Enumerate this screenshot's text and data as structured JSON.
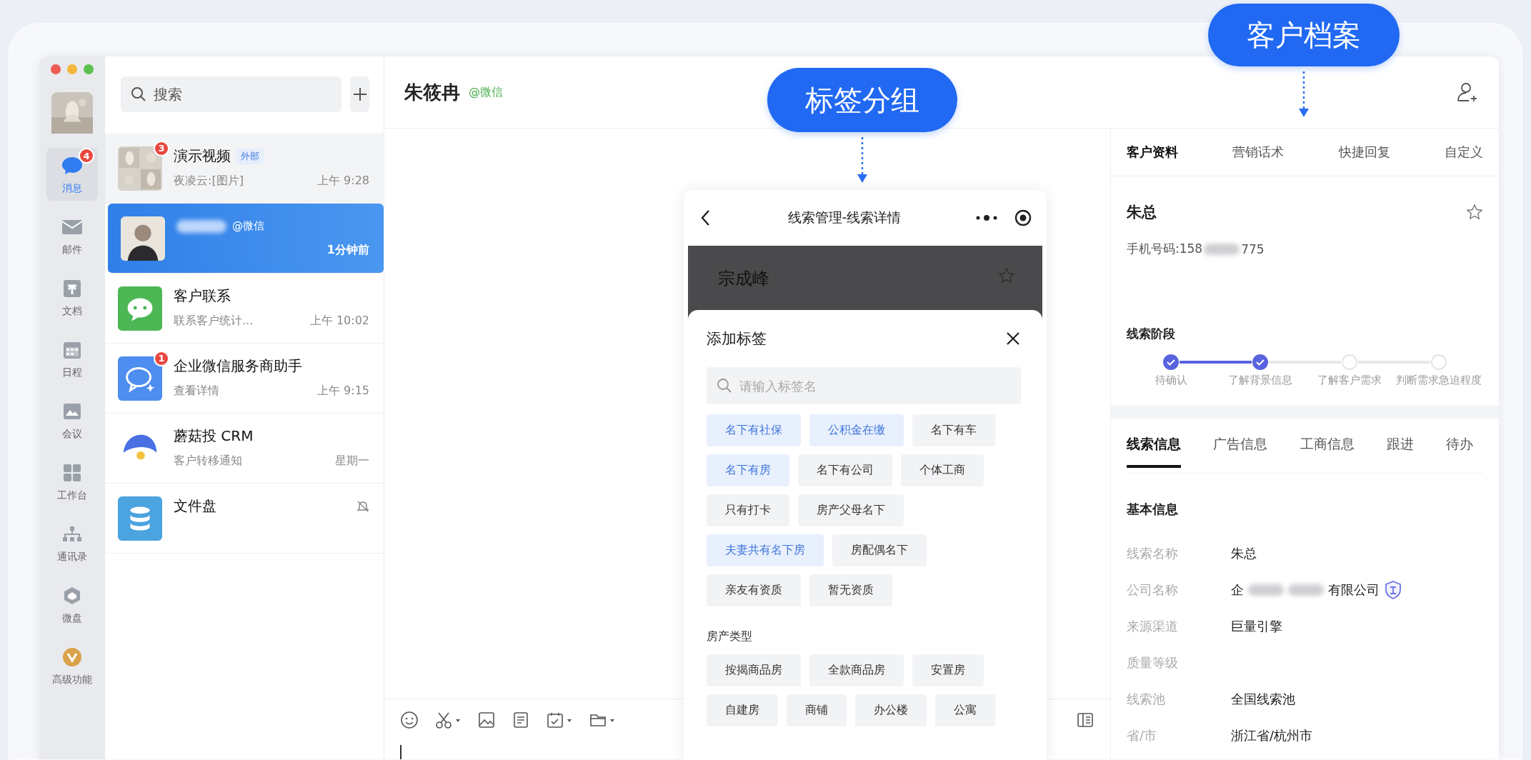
{
  "nav": [
    {
      "label": "消息",
      "kind": "chat",
      "badge": "4",
      "selected": true
    },
    {
      "label": "邮件",
      "kind": "mail",
      "selected": false
    },
    {
      "label": "文档",
      "kind": "doc",
      "selected": false
    },
    {
      "label": "日程",
      "kind": "calendar",
      "selected": false
    },
    {
      "label": "会议",
      "kind": "meeting",
      "selected": false
    },
    {
      "label": "工作台",
      "kind": "grid",
      "selected": false
    },
    {
      "label": "通讯录",
      "kind": "org",
      "selected": false
    },
    {
      "label": "微盘",
      "kind": "drive",
      "selected": false
    },
    {
      "label": "高级功能",
      "kind": "vip",
      "selected": false
    }
  ],
  "search": {
    "placeholder": "搜索"
  },
  "chats": [
    {
      "kind": "picture",
      "name": "演示视频",
      "tag": "外部",
      "preview": "夜凌云:[图片]",
      "time": "上午 9:28",
      "badge": "3",
      "selected": false
    },
    {
      "kind": "person",
      "name_blurred": true,
      "source": "@微信",
      "time": "1分钟前",
      "selected": true
    },
    {
      "kind": "wechat",
      "name": "客户联系",
      "preview": "联系客户统计...",
      "time": "上午 10:02",
      "selected": false
    },
    {
      "kind": "service",
      "name": "企业微信服务商助手",
      "preview": "查看详情",
      "time": "上午 9:15",
      "badge": "1",
      "selected": false
    },
    {
      "kind": "mushroom",
      "name": "蘑菇投 CRM",
      "preview": "客户转移通知",
      "time": "星期一",
      "selected": false
    },
    {
      "kind": "database",
      "name": "文件盘",
      "muted": true,
      "selected": false
    }
  ],
  "chat": {
    "title": "朱筱冉",
    "source": "@微信"
  },
  "callouts": [
    {
      "text": "标签分组"
    },
    {
      "text": "客户档案"
    }
  ],
  "phone": {
    "title": "线索管理-线索详情",
    "lead_name": "宗成峰",
    "sheet_title": "添加标签",
    "search_placeholder": "请输入标签名",
    "tags": [
      {
        "label": "名下有社保",
        "selected": true
      },
      {
        "label": "公积金在缴",
        "selected": true
      },
      {
        "label": "名下有车",
        "selected": false
      },
      {
        "label": "名下有房",
        "selected": true
      },
      {
        "label": "名下有公司",
        "selected": false
      },
      {
        "label": "个体工商",
        "selected": false
      },
      {
        "label": "只有打卡",
        "selected": false
      },
      {
        "label": "房产父母名下",
        "selected": false
      },
      {
        "label": "夫妻共有名下房",
        "selected": true
      },
      {
        "label": "房配偶名下",
        "selected": false
      },
      {
        "label": "亲友有资质",
        "selected": false
      },
      {
        "label": "暂无资质",
        "selected": false
      }
    ],
    "section": "房产类型",
    "tags2": [
      {
        "label": "按揭商品房",
        "selected": false
      },
      {
        "label": "全款商品房",
        "selected": false
      },
      {
        "label": "安置房",
        "selected": false
      },
      {
        "label": "自建房",
        "selected": false
      },
      {
        "label": "商铺",
        "selected": false
      },
      {
        "label": "办公楼",
        "selected": false
      },
      {
        "label": "公寓",
        "selected": false
      }
    ]
  },
  "profile": {
    "tabs": [
      {
        "label": "客户资料",
        "selected": true
      },
      {
        "label": "营销话术",
        "selected": false
      },
      {
        "label": "快捷回复",
        "selected": false
      },
      {
        "label": "自定义",
        "selected": false
      }
    ],
    "name": "朱总",
    "phone_prefix": "手机号码:158",
    "phone_suffix": "775",
    "stage_title": "线索阶段",
    "stages": [
      {
        "label": "待确认",
        "done": true
      },
      {
        "label": "了解背景信息",
        "done": true
      },
      {
        "label": "了解客户需求",
        "done": false
      },
      {
        "label": "判断需求急迫程度",
        "done": false
      }
    ],
    "info_tabs": [
      {
        "label": "线索信息",
        "selected": true
      },
      {
        "label": "广告信息",
        "selected": false
      },
      {
        "label": "工商信息",
        "selected": false
      },
      {
        "label": "跟进",
        "selected": false
      },
      {
        "label": "待办",
        "selected": false
      }
    ],
    "section": "基本信息",
    "fields": [
      {
        "label": "线索名称",
        "value": "朱总"
      },
      {
        "label": "公司名称",
        "value_prefix": "企",
        "value_suffix": "有限公司",
        "verified": true
      },
      {
        "label": "来源渠道",
        "value": "巨量引擎"
      },
      {
        "label": "质量等级"
      },
      {
        "label": "线索池",
        "value": "全国线索池"
      },
      {
        "label": "省/市",
        "value": "浙江省/杭州市"
      }
    ]
  }
}
